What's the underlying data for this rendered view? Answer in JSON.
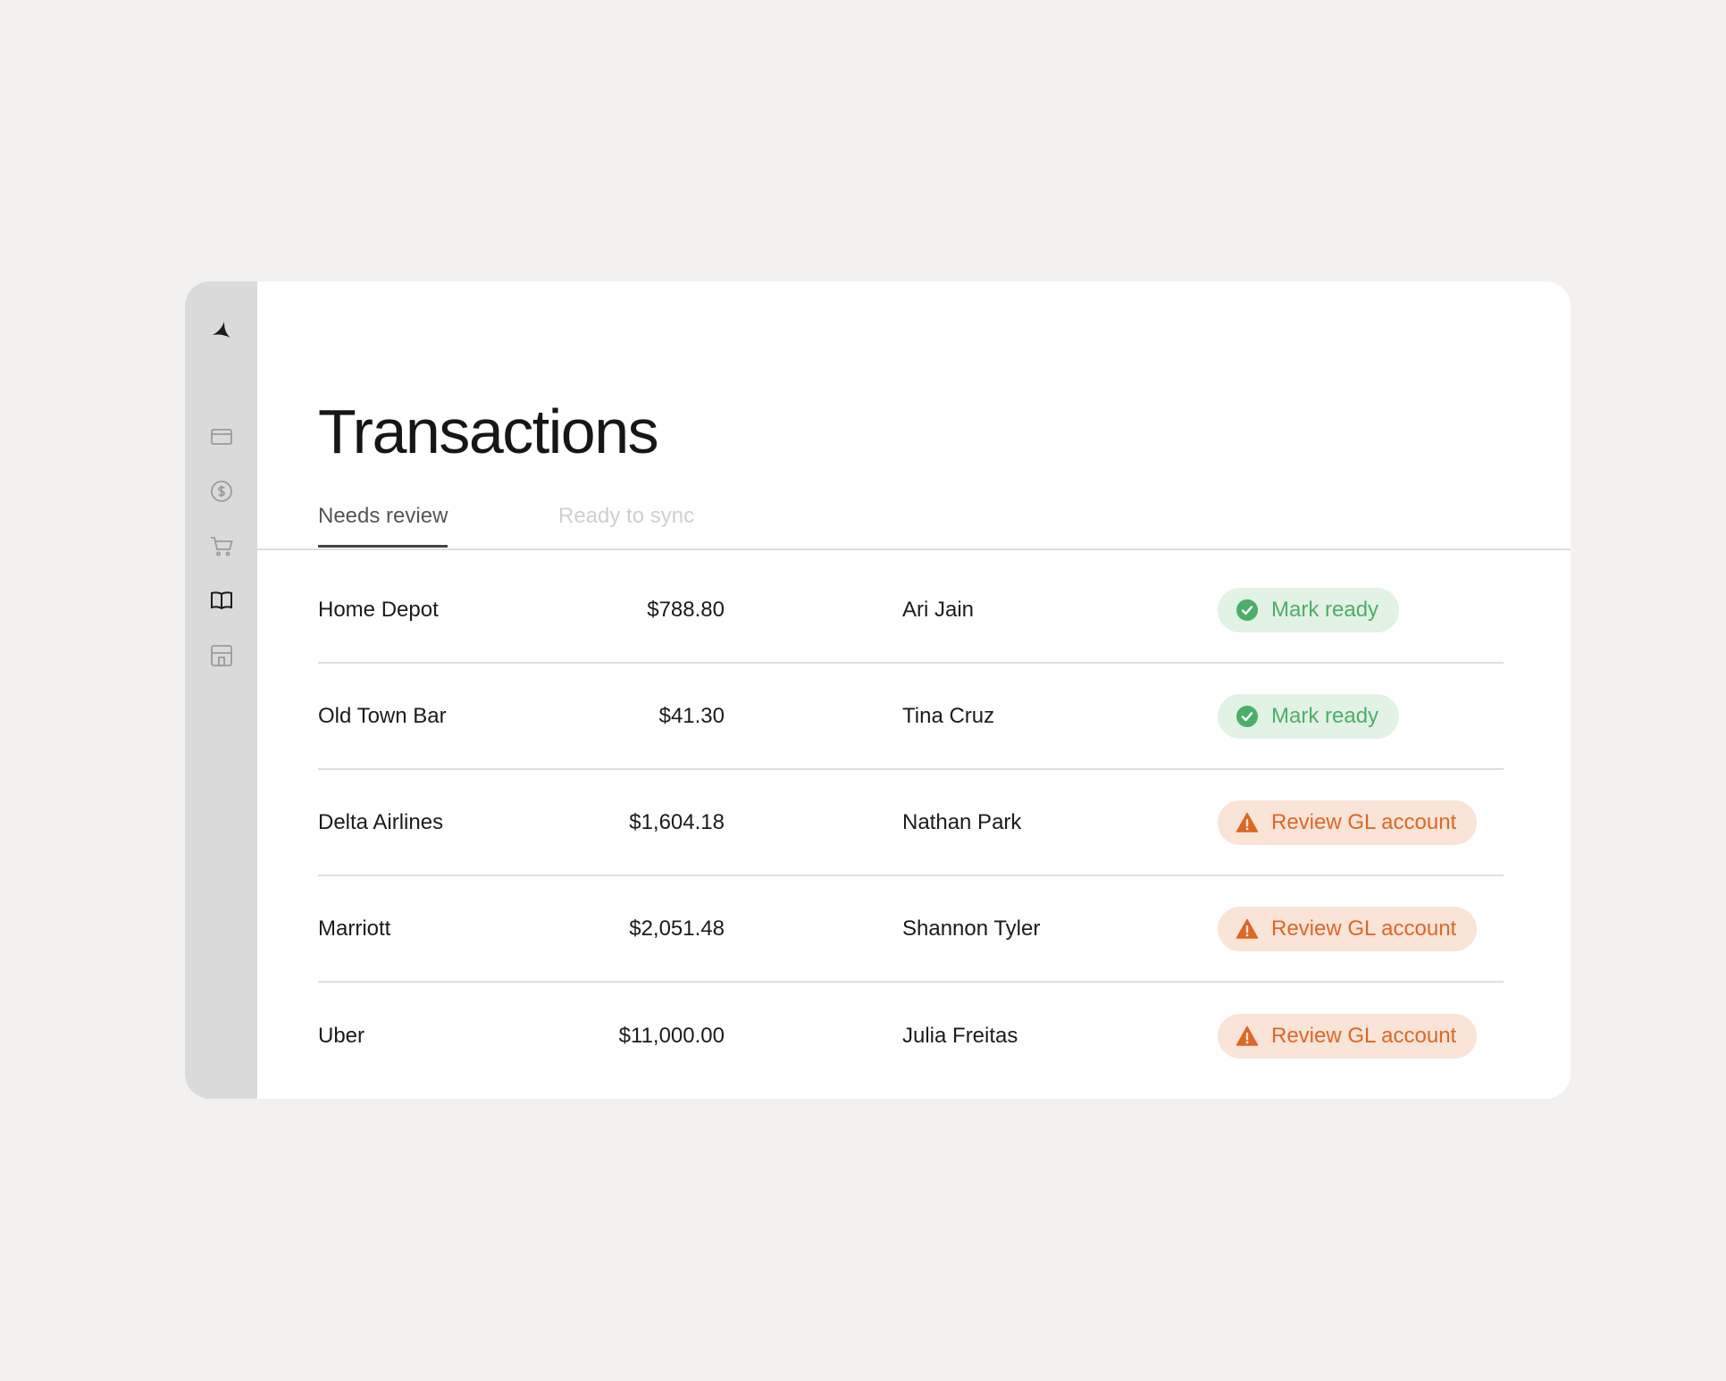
{
  "page": {
    "title": "Transactions"
  },
  "sidebar": {
    "items": [
      {
        "icon": "card-icon"
      },
      {
        "icon": "dollar-icon"
      },
      {
        "icon": "cart-icon"
      },
      {
        "icon": "book-icon",
        "active": true
      },
      {
        "icon": "store-icon"
      }
    ]
  },
  "tabs": [
    {
      "label": "Needs review",
      "active": true
    },
    {
      "label": "Ready to sync",
      "active": false
    }
  ],
  "transactions": [
    {
      "merchant": "Home Depot",
      "amount": "$788.80",
      "person": "Ari Jain",
      "action": "Mark ready",
      "status": "ready"
    },
    {
      "merchant": "Old Town Bar",
      "amount": "$41.30",
      "person": "Tina Cruz",
      "action": "Mark ready",
      "status": "ready"
    },
    {
      "merchant": "Delta Airlines",
      "amount": "$1,604.18",
      "person": "Nathan Park",
      "action": "Review GL account",
      "status": "review"
    },
    {
      "merchant": "Marriott",
      "amount": "$2,051.48",
      "person": "Shannon Tyler",
      "action": "Review GL account",
      "status": "review"
    },
    {
      "merchant": "Uber",
      "amount": "$11,000.00",
      "person": "Julia Freitas",
      "action": "Review GL account",
      "status": "review"
    }
  ],
  "colors": {
    "ready_bg": "#e2f2e5",
    "ready_fg": "#4caf68",
    "review_bg": "#fae4d8",
    "review_fg": "#dd6724",
    "sidebar_bg": "#dadada"
  }
}
